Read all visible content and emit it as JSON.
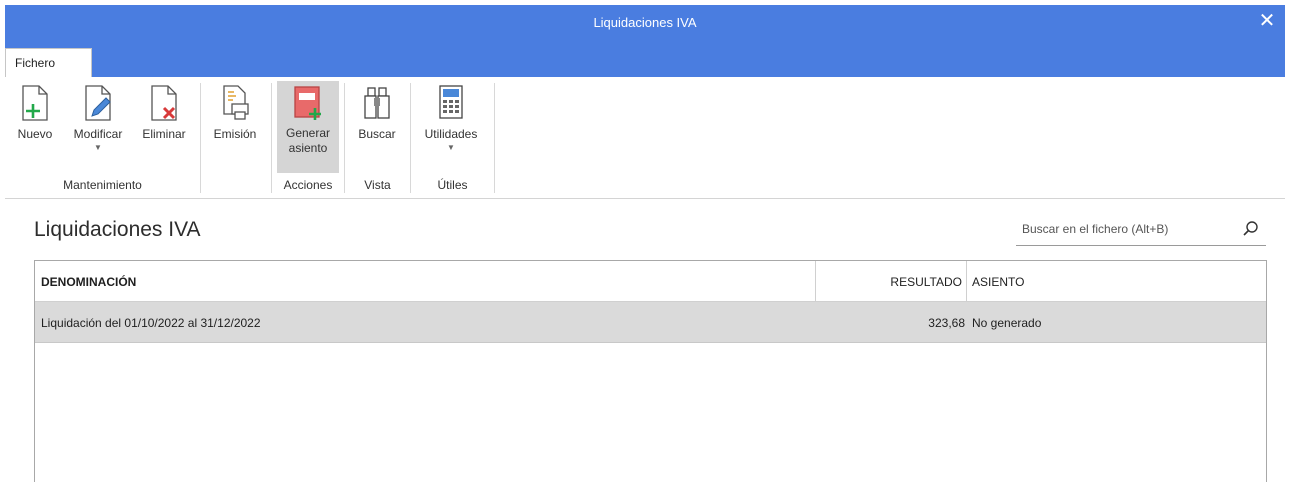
{
  "window": {
    "title": "Liquidaciones IVA",
    "close_label": "✕"
  },
  "ribbon_tab": "Fichero",
  "buttons": {
    "nuevo": "Nuevo",
    "modificar": "Modificar",
    "eliminar": "Eliminar",
    "emision": "Emisión",
    "generar_1": "Generar",
    "generar_2": "asiento",
    "buscar": "Buscar",
    "utilidades": "Utilidades"
  },
  "groups": {
    "mantenimiento": "Mantenimiento",
    "acciones": "Acciones",
    "vista": "Vista",
    "utiles": "Útiles"
  },
  "page_title": "Liquidaciones IVA",
  "search": {
    "placeholder": "Buscar en el fichero (Alt+B)"
  },
  "table": {
    "columns": [
      "DENOMINACIÓN",
      "RESULTADO",
      "ASIENTO"
    ],
    "rows": [
      {
        "denominacion": "Liquidación del 01/10/2022 al 31/12/2022",
        "resultado": "323,68",
        "asiento": "No generado"
      }
    ]
  },
  "colors": {
    "titlebar": "#4a7de0",
    "selected_row": "#dadada",
    "active_button": "#d5d5d5",
    "add_green": "#22a84a",
    "delete_red": "#d83a3a"
  }
}
